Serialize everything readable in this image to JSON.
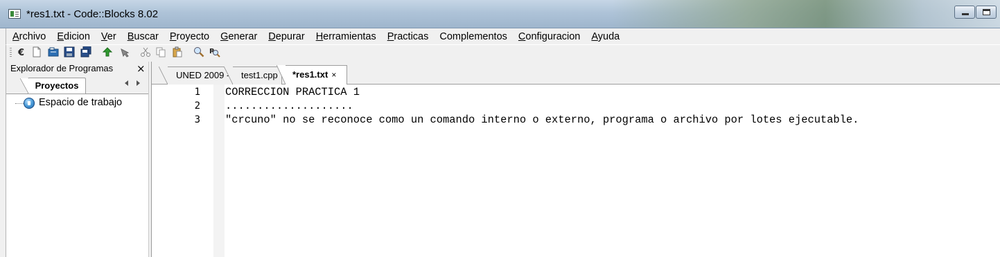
{
  "window": {
    "title": "*res1.txt - Code::Blocks 8.02"
  },
  "menu": [
    {
      "pre": "",
      "acc": "A",
      "post": "rchivo"
    },
    {
      "pre": "",
      "acc": "E",
      "post": "dicion"
    },
    {
      "pre": "",
      "acc": "V",
      "post": "er"
    },
    {
      "pre": "",
      "acc": "B",
      "post": "uscar"
    },
    {
      "pre": "",
      "acc": "P",
      "post": "royecto"
    },
    {
      "pre": "",
      "acc": "G",
      "post": "enerar"
    },
    {
      "pre": "",
      "acc": "D",
      "post": "epurar"
    },
    {
      "pre": "",
      "acc": "H",
      "post": "erramientas"
    },
    {
      "pre": "",
      "acc": "P",
      "post": "racticas"
    },
    {
      "pre": "Complementos",
      "acc": "",
      "post": ""
    },
    {
      "pre": "",
      "acc": "C",
      "post": "onfiguracion"
    },
    {
      "pre": "",
      "acc": "A",
      "post": "yuda"
    }
  ],
  "toolbar": [
    "new-project-icon",
    "new-file-icon",
    "open-icon",
    "save-icon",
    "save-all-icon",
    "undo-icon",
    "redo-icon",
    "cut-icon",
    "copy-icon",
    "paste-icon",
    "find-icon",
    "replace-icon"
  ],
  "left_panel": {
    "title": "Explorador de Programas",
    "close": "×",
    "tab": "Proyectos",
    "tree": [
      {
        "label": "Espacio de trabajo",
        "icon": "workspace-icon"
      }
    ]
  },
  "editor_tabs": [
    {
      "label": "UNED 2009 -"
    },
    {
      "label": "test1.cpp"
    },
    {
      "label": "*res1.txt",
      "active": true,
      "close": "×"
    }
  ],
  "editor": {
    "lines": [
      {
        "no": "1",
        "text": "CORRECCION PRACTICA 1"
      },
      {
        "no": "2",
        "text": "...................."
      },
      {
        "no": "3",
        "text": "\"crcuno\" no se reconoce como un comando interno o externo, programa o archivo por lotes ejecutable."
      }
    ]
  }
}
